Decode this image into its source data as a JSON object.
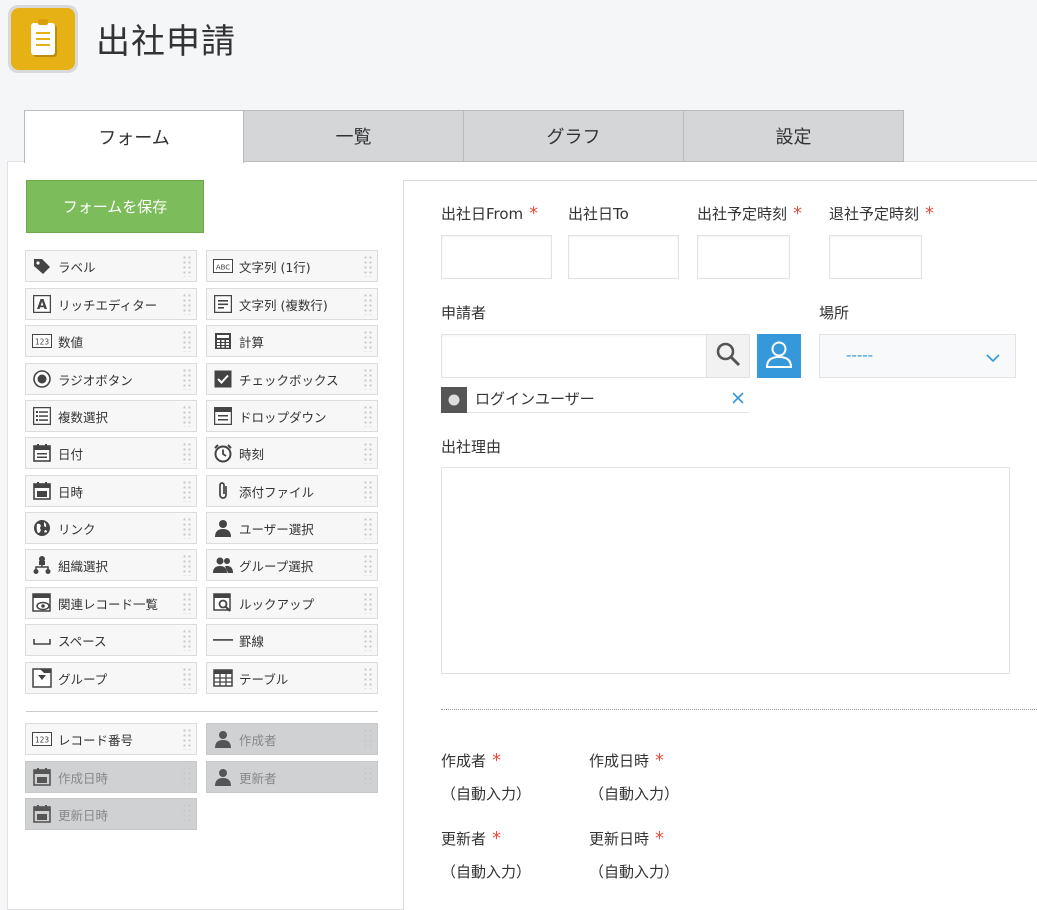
{
  "header": {
    "title": "出社申請",
    "icon": "clipboard-icon",
    "icon_color": "#e6b115"
  },
  "tabs": [
    {
      "label": "フォーム",
      "active": true
    },
    {
      "label": "一覧",
      "active": false
    },
    {
      "label": "グラフ",
      "active": false
    },
    {
      "label": "設定",
      "active": false
    }
  ],
  "palette": {
    "save_label": "フォームを保存",
    "fields": [
      {
        "label": "ラベル",
        "icon": "tag-icon"
      },
      {
        "label": "文字列 (1行)",
        "icon": "abc-text-icon"
      },
      {
        "label": "リッチエディター",
        "icon": "rich-editor-icon"
      },
      {
        "label": "文字列 (複数行)",
        "icon": "multiline-text-icon"
      },
      {
        "label": "数値",
        "icon": "number-123-icon"
      },
      {
        "label": "計算",
        "icon": "calculator-icon"
      },
      {
        "label": "ラジオボタン",
        "icon": "radio-icon"
      },
      {
        "label": "チェックボックス",
        "icon": "checkbox-icon"
      },
      {
        "label": "複数選択",
        "icon": "multi-select-icon"
      },
      {
        "label": "ドロップダウン",
        "icon": "dropdown-icon"
      },
      {
        "label": "日付",
        "icon": "date-icon"
      },
      {
        "label": "時刻",
        "icon": "clock-icon"
      },
      {
        "label": "日時",
        "icon": "datetime-icon"
      },
      {
        "label": "添付ファイル",
        "icon": "paperclip-icon"
      },
      {
        "label": "リンク",
        "icon": "globe-icon"
      },
      {
        "label": "ユーザー選択",
        "icon": "user-icon"
      },
      {
        "label": "組織選択",
        "icon": "org-icon"
      },
      {
        "label": "グループ選択",
        "icon": "group-icon"
      },
      {
        "label": "関連レコード一覧",
        "icon": "related-records-icon"
      },
      {
        "label": "ルックアップ",
        "icon": "lookup-icon"
      },
      {
        "label": "スペース",
        "icon": "space-icon"
      },
      {
        "label": "罫線",
        "icon": "line-icon"
      },
      {
        "label": "グループ",
        "icon": "group-folder-icon"
      },
      {
        "label": "テーブル",
        "icon": "table-icon"
      }
    ],
    "system_fields": [
      {
        "label": "レコード番号",
        "icon": "number-123-icon",
        "disabled": false
      },
      {
        "label": "作成者",
        "icon": "user-icon",
        "disabled": true
      },
      {
        "label": "作成日時",
        "icon": "datetime-icon",
        "disabled": true
      },
      {
        "label": "更新者",
        "icon": "user-icon",
        "disabled": true
      },
      {
        "label": "更新日時",
        "icon": "datetime-icon",
        "disabled": true
      }
    ]
  },
  "form": {
    "fields": {
      "date_from": "出社日From",
      "date_to": "出社日To",
      "start_time": "出社予定時刻",
      "end_time": "退社予定時刻",
      "applicant": "申請者",
      "location": "場所",
      "reason": "出社理由"
    },
    "location_value": "-----",
    "login_user": "ログインユーザー",
    "system": {
      "creator": "作成者",
      "created_at": "作成日時",
      "updater": "更新者",
      "updated_at": "更新日時",
      "auto": "（自動入力）"
    },
    "colors": {
      "required": "#e74c3c",
      "accent": "#3598db",
      "save": "#7cbc5a"
    }
  }
}
